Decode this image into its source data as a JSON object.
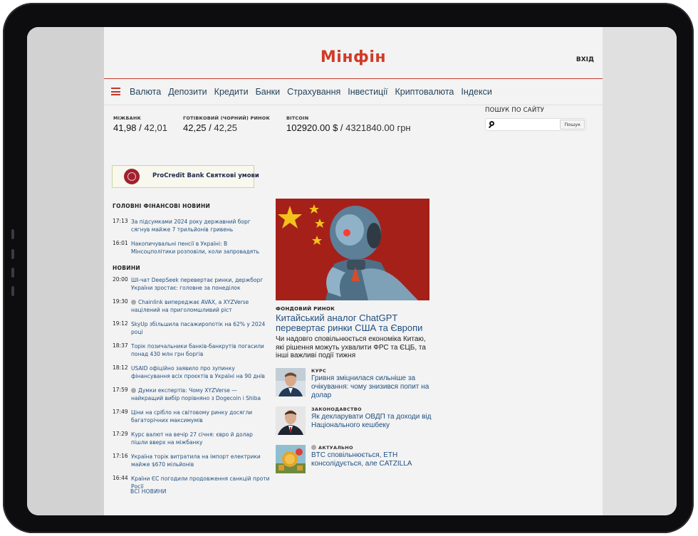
{
  "brand": {
    "logo": "Мінфін",
    "login": "ВХІД"
  },
  "nav": {
    "items": [
      "Валюта",
      "Депозити",
      "Кредити",
      "Банки",
      "Страхування",
      "Інвестиції",
      "Криптовалюта",
      "Індекси"
    ]
  },
  "rates": [
    {
      "label": "МІЖБАНК",
      "buy": "41,98",
      "sep": "/",
      "sell": "42,01"
    },
    {
      "label": "ГОТІВКОВИЙ (ЧОРНИЙ) РИНОК",
      "buy": "42,25",
      "sep": "/",
      "sell": "42,25"
    },
    {
      "label": "BITCOIN",
      "buy": "102920.00 $",
      "sep": "/",
      "sell": "4321840.00 грн"
    }
  ],
  "search": {
    "label": "ПОШУК ПО САЙТУ",
    "button": "Пошук"
  },
  "promo": {
    "text": "ProCredit Bank Святкові умови"
  },
  "main_news": {
    "title": "ГОЛОВНІ ФІНАНСОВІ НОВИНИ",
    "items": [
      {
        "time": "17:13",
        "text": "За підсумками 2024 року державний борг сягнув майже 7 трильйонів гривень"
      },
      {
        "time": "16:01",
        "text": "Накопичувальні пенсії в Україні: В Мінсоцполітики розповіли, коли запровадять"
      }
    ]
  },
  "news": {
    "title": "НОВИНИ",
    "items": [
      {
        "time": "20:00",
        "text": "ШІ-чат DeepSeek перевертає ринки, держборг України зростає: головне за понеділок"
      },
      {
        "time": "19:30",
        "text": "Chainlink випереджає AVAX, а XYZVerse націлений на приголомшливий ріст"
      },
      {
        "time": "19:12",
        "text": "SkyUp збільшила пасажиропотік на 62% у 2024 році"
      },
      {
        "time": "18:37",
        "text": "Торік позичальники банків-банкрутів погасили понад 430 млн грн боргів"
      },
      {
        "time": "18:12",
        "text": "USAID офіційно заявило про зупинку фінансування всіх проєктів в Україні на 90 днів"
      },
      {
        "time": "17:59",
        "text": "Думки експертів: Чому XYZVerse — найкращий вибір порівняно з Dogecoin і Shiba"
      },
      {
        "time": "17:49",
        "text": "Ціни на срібло на світовому ринку досягли багаторічних максимумів"
      },
      {
        "time": "17:29",
        "text": "Курс валют на вечір 27 січня: євро й долар пішли вверх на міжбанку"
      },
      {
        "time": "17:16",
        "text": "Україна торік витратила на імпорт електрики майже $670 мільйонів"
      },
      {
        "time": "16:44",
        "text": "Країни ЄС погодили продовження санкцій проти Росії"
      }
    ],
    "all_link": "ВСІ НОВИНИ"
  },
  "hero": {
    "category": "ФОНДОВИЙ РИНОК",
    "title": "Китайський аналог ChatGPT перевертає ринки США та Європи",
    "lead": "Чи надовго сповільнюється економіка Китаю, які рішення можуть ухвалити ФРС та ЄЦБ, та інші важливі події тижня"
  },
  "side_news": [
    {
      "category": "КУРС",
      "title": "Гривня зміцнилася сильніше за очікування: чому знизився попит на долар"
    },
    {
      "category": "ЗАКОНОДАВСТВО",
      "title": "Як декларувати ОВДП та доходи від Національного кешбеку"
    },
    {
      "category": "АКТУАЛЬНО",
      "title": "BTC сповільнюється, ETH консолідується, але CATZILLA"
    }
  ],
  "colors": {
    "brand_red": "#d03b2a",
    "link_blue": "#1f4f80",
    "nav_text": "#24445c"
  }
}
